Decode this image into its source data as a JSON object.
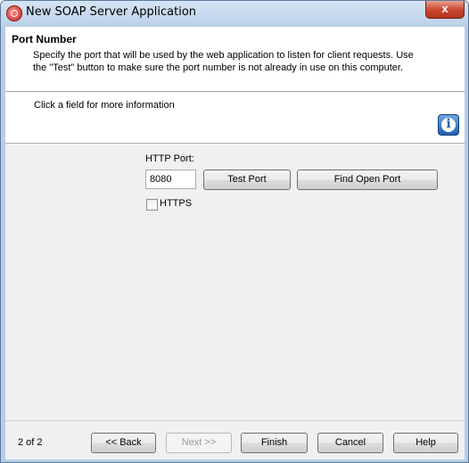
{
  "window": {
    "title": "New SOAP Server Application",
    "close_glyph": "x"
  },
  "header": {
    "title": "Port Number",
    "description": "Specify the port that will be used by the web application to listen for client requests.  Use the \"Test\" button to make sure the port number is not already in use on this computer."
  },
  "info": {
    "text": "Click a field for more information",
    "icon_glyph": "i"
  },
  "form": {
    "http_port_label": "HTTP Port:",
    "http_port_value": "8080",
    "test_port_label": "Test Port",
    "find_open_port_label": "Find Open Port",
    "https_label": "HTTPS",
    "https_checked": false
  },
  "footer": {
    "page_indicator": "2 of 2",
    "back_label": "<< Back",
    "next_label": "Next >>",
    "next_enabled": false,
    "finish_label": "Finish",
    "cancel_label": "Cancel",
    "help_label": "Help"
  }
}
